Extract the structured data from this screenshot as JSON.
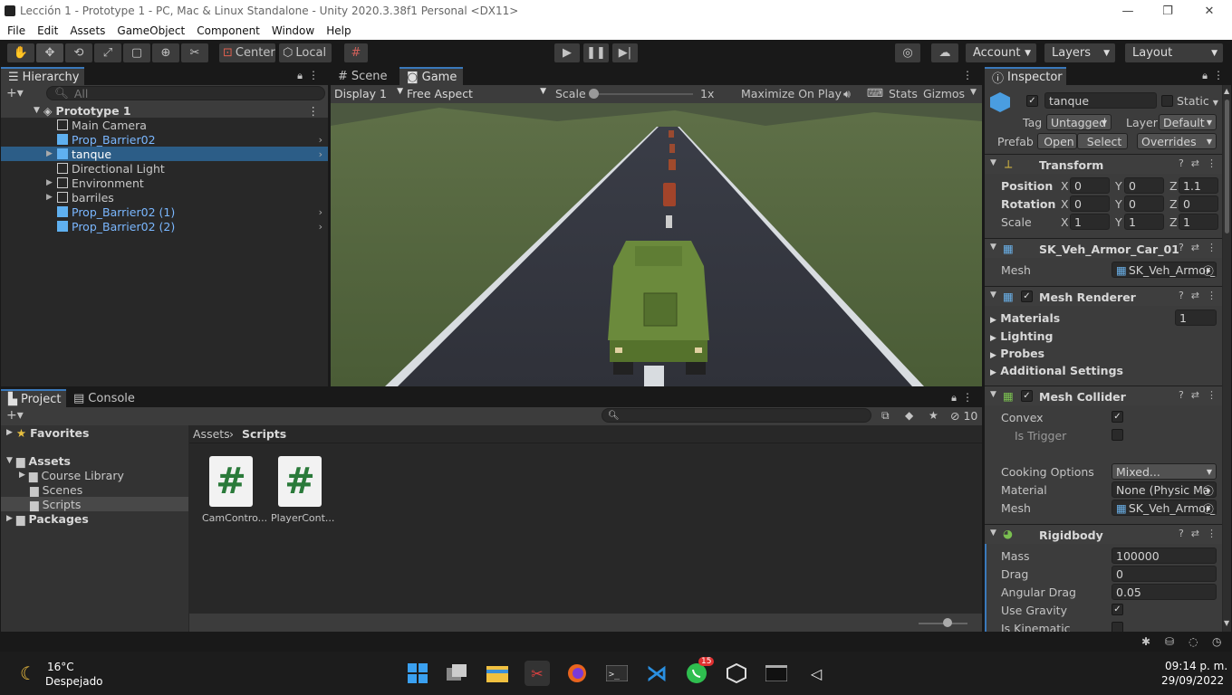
{
  "window": {
    "title": "Lección 1 - Prototype 1 - PC, Mac & Linux Standalone - Unity 2020.3.38f1 Personal <DX11>"
  },
  "menu": [
    "File",
    "Edit",
    "Assets",
    "GameObject",
    "Component",
    "Window",
    "Help"
  ],
  "toolbar": {
    "center_label": "Center",
    "local_label": "Local",
    "account_label": "Account",
    "layers_label": "Layers",
    "layout_label": "Layout"
  },
  "hierarchy": {
    "tab": "Hierarchy",
    "search_placeholder": "All",
    "scene_name": "Prototype 1",
    "items": [
      {
        "label": "Main Camera",
        "style": "normal",
        "expand": false,
        "more": false
      },
      {
        "label": "Prop_Barrier02",
        "style": "prefab",
        "expand": false,
        "more": true
      },
      {
        "label": "tanque",
        "style": "selected",
        "expand": true,
        "more": true
      },
      {
        "label": "Directional Light",
        "style": "normal",
        "expand": false,
        "more": false
      },
      {
        "label": "Environment",
        "style": "normal",
        "expand": true,
        "more": false
      },
      {
        "label": "barriles",
        "style": "normal",
        "expand": true,
        "more": false
      },
      {
        "label": "Prop_Barrier02 (1)",
        "style": "prefab",
        "expand": false,
        "more": true
      },
      {
        "label": "Prop_Barrier02 (2)",
        "style": "prefab",
        "expand": false,
        "more": true
      }
    ]
  },
  "game_view": {
    "tabs": [
      "Scene",
      "Game"
    ],
    "display": "Display 1",
    "aspect": "Free Aspect",
    "scale_label": "Scale",
    "scale_value": "1x",
    "maximize_label": "Maximize On Play",
    "stats_label": "Stats",
    "gizmos_label": "Gizmos"
  },
  "project": {
    "tabs": [
      "Project",
      "Console"
    ],
    "favorites": "Favorites",
    "assets": "Assets",
    "folders": [
      "Course Library",
      "Scenes",
      "Scripts"
    ],
    "packages": "Packages",
    "breadcrumb": [
      "Assets",
      "Scripts"
    ],
    "hidden_count": "10",
    "files": [
      "CamContro...",
      "PlayerCont..."
    ]
  },
  "inspector": {
    "tab": "Inspector",
    "object_name": "tanque",
    "static_label": "Static",
    "tag_label": "Tag",
    "tag_value": "Untagged",
    "layer_label": "Layer",
    "layer_value": "Default",
    "prefab_label": "Prefab",
    "open_label": "Open",
    "select_label": "Select",
    "overrides_label": "Overrides",
    "transform": {
      "title": "Transform",
      "position_label": "Position",
      "position": [
        "0",
        "0",
        "1.1"
      ],
      "rotation_label": "Rotation",
      "rotation": [
        "0",
        "0",
        "0"
      ],
      "scale_label": "Scale",
      "scale": [
        "1",
        "1",
        "1"
      ]
    },
    "mesh_filter": {
      "title": "SK_Veh_Armor_Car_01",
      "mesh_label": "Mesh",
      "mesh_value": "SK_Veh_Armor_"
    },
    "mesh_renderer": {
      "title": "Mesh Renderer",
      "materials": "Materials",
      "materials_count": "1",
      "lighting": "Lighting",
      "probes": "Probes",
      "additional": "Additional Settings"
    },
    "mesh_collider": {
      "title": "Mesh Collider",
      "convex": "Convex",
      "is_trigger": "Is Trigger",
      "cooking_label": "Cooking Options",
      "cooking_value": "Mixed...",
      "material_label": "Material",
      "material_value": "None (Physic Ma",
      "mesh_label": "Mesh",
      "mesh_value": "SK_Veh_Armor_"
    },
    "rigidbody": {
      "title": "Rigidbody",
      "mass_label": "Mass",
      "mass": "100000",
      "drag_label": "Drag",
      "drag": "0",
      "angular_label": "Angular Drag",
      "angular": "0.05",
      "gravity_label": "Use Gravity",
      "kinematic_label": "Is Kinematic"
    }
  },
  "taskbar": {
    "temp": "16°C",
    "weather": "Despejado",
    "time": "09:14 p. m.",
    "date": "29/09/2022",
    "whatsapp_badge": "15"
  }
}
